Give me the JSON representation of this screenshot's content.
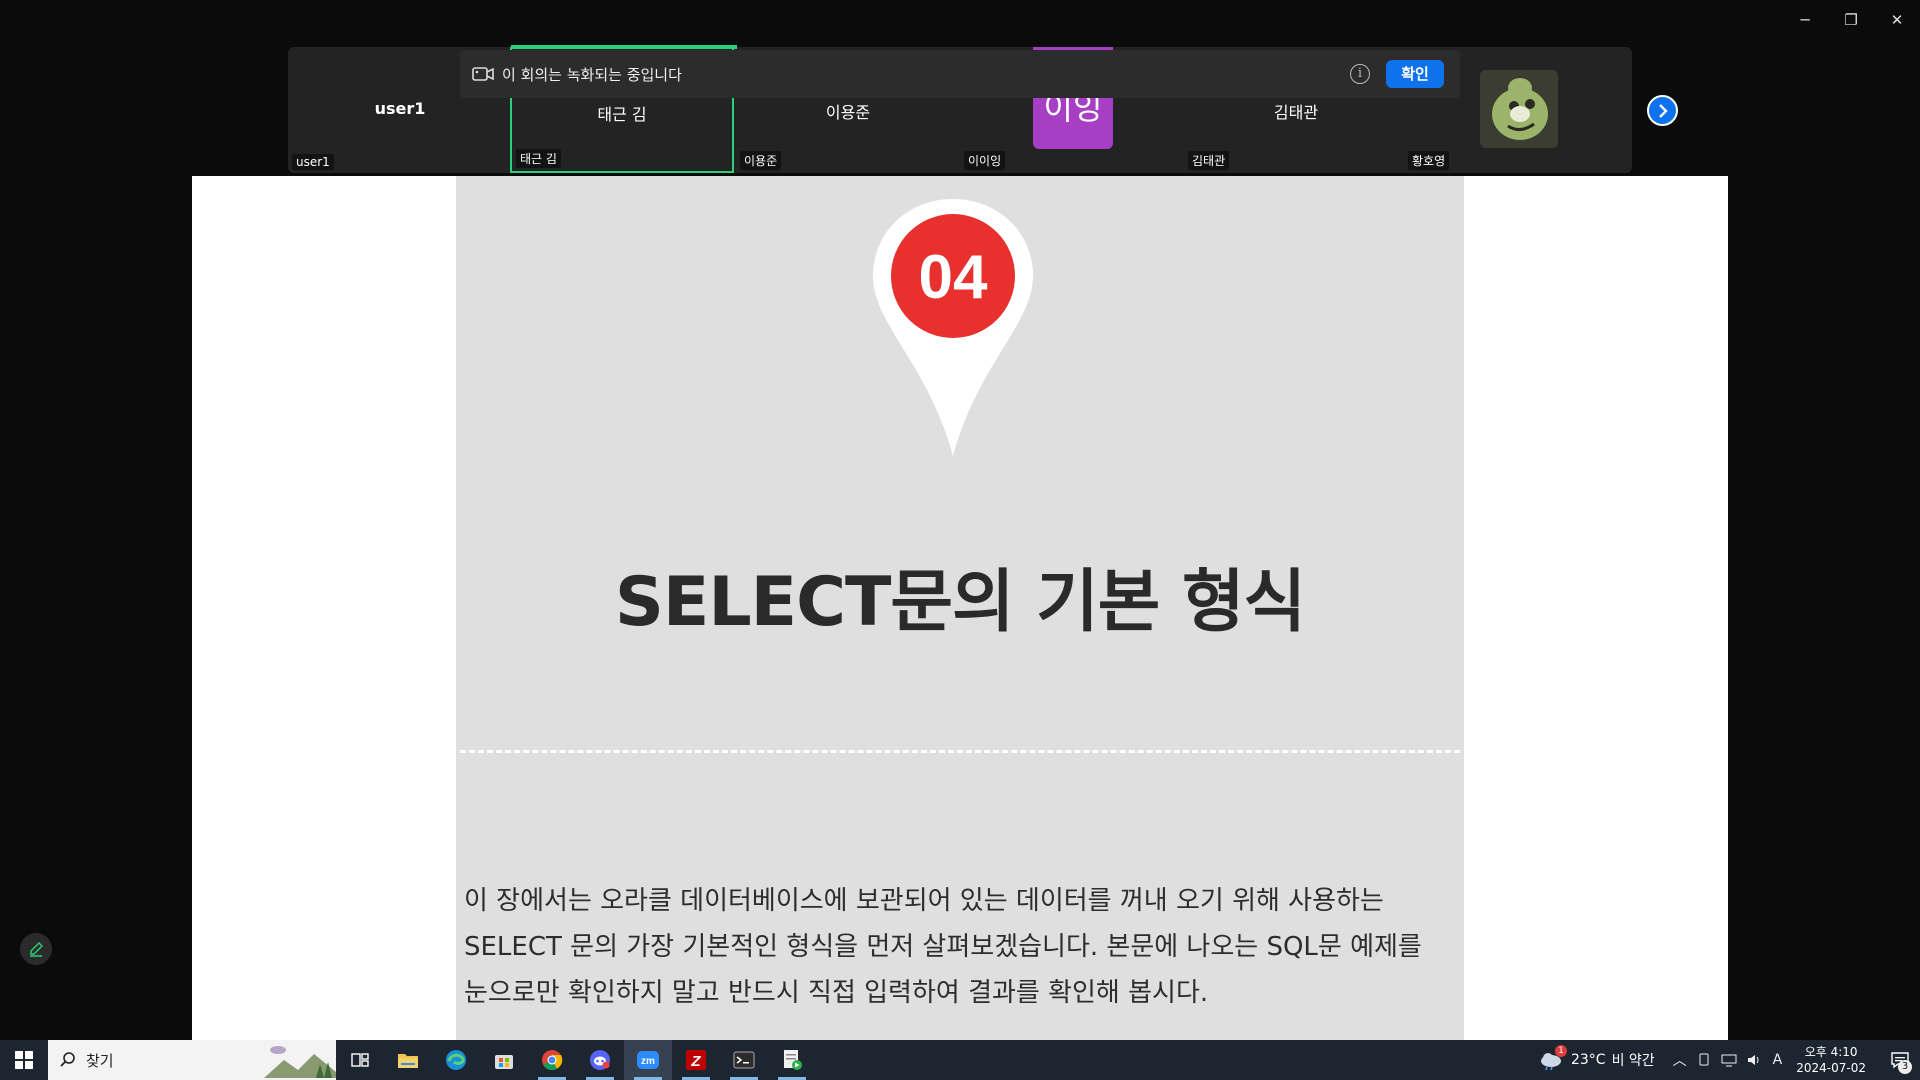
{
  "window": {
    "controls": {
      "minimize": "─",
      "restore": "❐",
      "close": "✕"
    }
  },
  "recording_banner": {
    "message": "이 회의는 녹화되는 중입니다",
    "info_glyph": "i",
    "confirm_label": "확인"
  },
  "participants": [
    {
      "center_name": "user1",
      "tag": "user1"
    },
    {
      "center_name": "태근 김",
      "tag": "태근 김",
      "active_speaker": true
    },
    {
      "center_name": "이용준",
      "tag": "이용준"
    },
    {
      "avatar_text": "이잉",
      "tag": "이이잉",
      "avatar_color": "#a63fc4"
    },
    {
      "center_name": "김태관",
      "tag": "김태관"
    },
    {
      "tag": "황호영",
      "avatar": "photo"
    }
  ],
  "slide": {
    "badge": "04",
    "title": "SELECT문의 기본 형식",
    "body": "이 장에서는 오라클 데이터베이스에 보관되어 있는 데이터를 꺼내 오기 위해 사용하는 SELECT 문의 가장 기본적인 형식을 먼저 살펴보겠습니다. 본문에 나오는 SQL문 예제를 눈으로만 확인하지 말고 반드시 직접 입력하여 결과를 확인해 봅시다.",
    "badge_color": "#e8312f"
  },
  "taskbar": {
    "search_placeholder": "찾기",
    "apps": [
      "task-view",
      "file-explorer",
      "edge",
      "microsoft-store",
      "chrome",
      "discord",
      "zoom",
      "filezilla",
      "terminal",
      "notepad-app"
    ],
    "weather": {
      "temp": "23°C",
      "desc": "비 약간",
      "alert_count": "1"
    },
    "ime": "A",
    "clock": {
      "time": "오후 4:10",
      "date": "2024-07-02"
    },
    "notifications": "3"
  },
  "colors": {
    "accent": "#0e72ed",
    "active_speaker": "#2ad07a",
    "taskbar": "#1c2530"
  }
}
